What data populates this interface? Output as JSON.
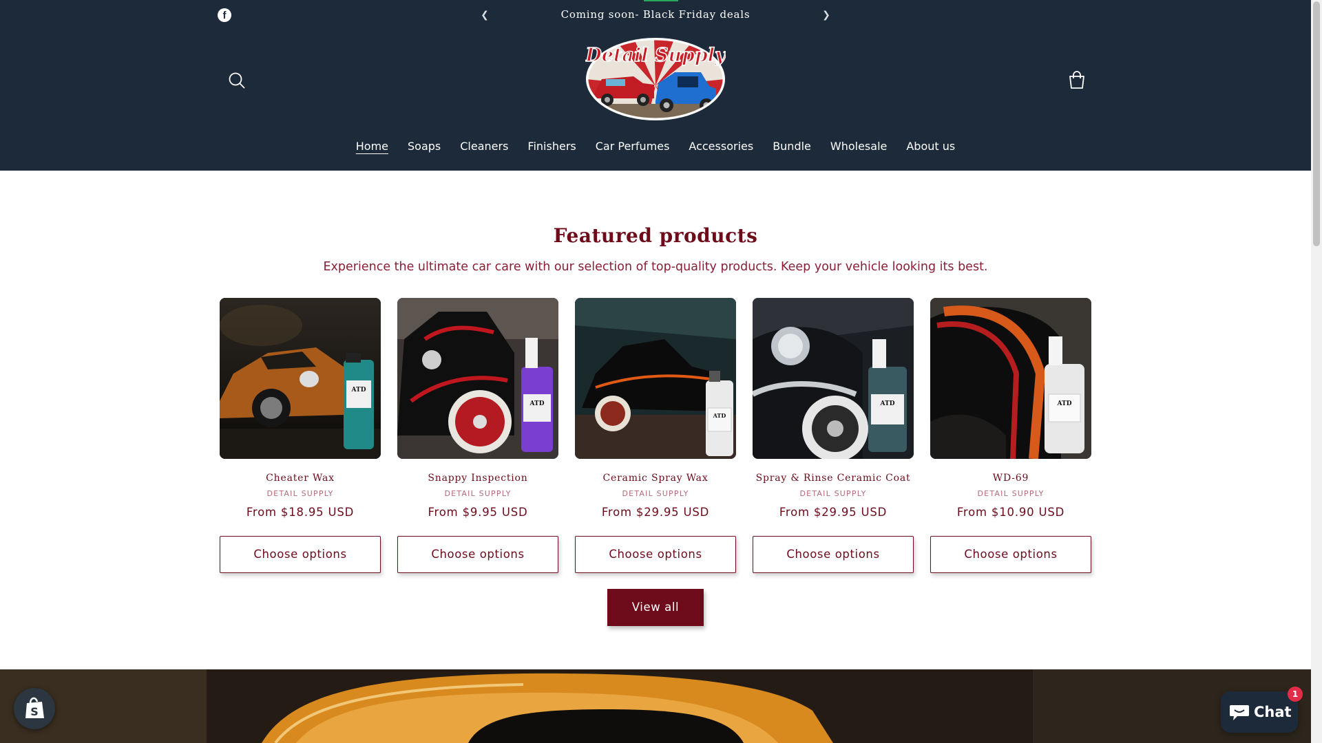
{
  "announcement": {
    "message": "Coming soon- Black Friday deals",
    "prev_icon": "chevron-left-icon",
    "next_icon": "chevron-right-icon",
    "social_icon": "facebook-icon",
    "social_glyph": "f"
  },
  "header": {
    "logo_text": "Detail Supply",
    "search_icon": "search-icon",
    "cart_icon": "cart-icon",
    "background_color": "#1c2a3a"
  },
  "nav": {
    "items": [
      {
        "label": "Home",
        "active": true
      },
      {
        "label": "Soaps",
        "active": false
      },
      {
        "label": "Cleaners",
        "active": false
      },
      {
        "label": "Finishers",
        "active": false
      },
      {
        "label": "Car Perfumes",
        "active": false
      },
      {
        "label": "Accessories",
        "active": false
      },
      {
        "label": "Bundle",
        "active": false
      },
      {
        "label": "Wholesale",
        "active": false
      },
      {
        "label": "About us",
        "active": false
      }
    ]
  },
  "featured": {
    "title": "Featured products",
    "subtitle": "Experience the ultimate car care with our selection of top-quality products. Keep your vehicle looking its best.",
    "products": [
      {
        "name": "Cheater Wax",
        "vendor": "DETAIL SUPPLY",
        "price": "From $18.95 USD",
        "button": "Choose options",
        "image_label": "ATD"
      },
      {
        "name": "Snappy Inspection",
        "vendor": "DETAIL SUPPLY",
        "price": "From $9.95 USD",
        "button": "Choose options",
        "image_label": "ATD"
      },
      {
        "name": "Ceramic Spray Wax",
        "vendor": "DETAIL SUPPLY",
        "price": "From $29.95 USD",
        "button": "Choose options",
        "image_label": "ATD"
      },
      {
        "name": "Spray & Rinse Ceramic Coat",
        "vendor": "DETAIL SUPPLY",
        "price": "From $29.95 USD",
        "button": "Choose options",
        "image_label": "ATD"
      },
      {
        "name": "WD-69",
        "vendor": "DETAIL SUPPLY",
        "price": "From $10.90 USD",
        "button": "Choose options",
        "image_label": "ATD"
      }
    ],
    "view_all": "View all"
  },
  "chat": {
    "label": "Chat",
    "badge_count": "1",
    "icon": "chat-bubble-icon"
  },
  "shop_badge": {
    "icon": "shopping-bag-icon",
    "glyph": "S"
  },
  "colors": {
    "brand_dark": "#1c2a3a",
    "accent": "#6e0b1b",
    "badge": "#e32c48"
  }
}
